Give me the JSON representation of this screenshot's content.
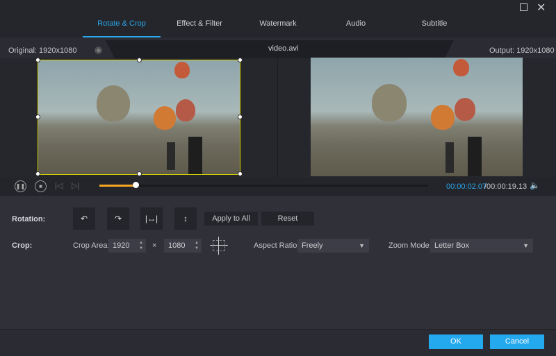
{
  "window": {
    "maximize_icon": "square-icon",
    "close_icon": "x-icon"
  },
  "tabs": [
    {
      "label": "Rotate & Crop",
      "active": true
    },
    {
      "label": "Effect & Filter"
    },
    {
      "label": "Watermark"
    },
    {
      "label": "Audio"
    },
    {
      "label": "Subtitle"
    }
  ],
  "header": {
    "original": "Original: 1920x1080",
    "filename": "video.avi",
    "output": "Output: 1920x1080"
  },
  "player": {
    "current_time": "00:00:02.07",
    "total_time": "/00:00:19.13",
    "progress_percent": 11,
    "accent": "#f5a623"
  },
  "rotation": {
    "label": "Rotation:",
    "apply_all": "Apply to All",
    "reset": "Reset"
  },
  "crop": {
    "label": "Crop:",
    "area_label": "Crop Area:",
    "width": "1920",
    "times": "×",
    "height": "1080",
    "aspect_label": "Aspect Ratio:",
    "aspect_value": "Freely",
    "zoom_label": "Zoom Mode:",
    "zoom_value": "Letter Box"
  },
  "footer": {
    "ok": "OK",
    "cancel": "Cancel"
  },
  "colors": {
    "accent": "#2aa6e8",
    "crop_border": "#d4d000"
  }
}
